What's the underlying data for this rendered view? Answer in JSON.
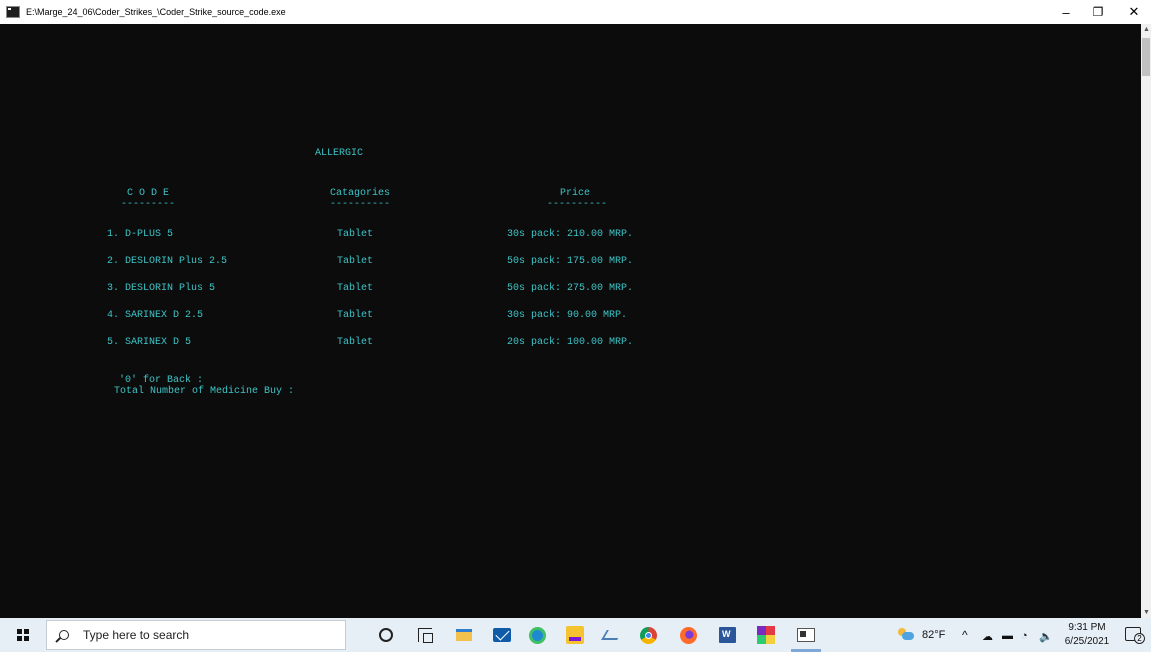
{
  "window": {
    "title": "E:\\Marge_24_06\\Coder_Strikes_\\Coder_Strike_source_code.exe",
    "controls": {
      "minimize": "–",
      "maximize": "❐",
      "close": "✕"
    }
  },
  "console": {
    "heading": "ALLERGIC",
    "columns": {
      "code": "C O D E",
      "code_rule": "---------",
      "categories": "Catagories",
      "categories_rule": "----------",
      "price": "Price",
      "price_rule": "----------"
    },
    "rows": [
      {
        "code": "1. D-PLUS 5",
        "category": "Tablet",
        "price": "30s pack: 210.00 MRP."
      },
      {
        "code": "2. DESLORIN Plus 2.5",
        "category": "Tablet",
        "price": "50s pack: 175.00 MRP."
      },
      {
        "code": "3. DESLORIN Plus 5",
        "category": "Tablet",
        "price": "50s pack: 275.00 MRP."
      },
      {
        "code": "4. SARINEX D 2.5",
        "category": "Tablet",
        "price": "30s pack: 90.00 MRP."
      },
      {
        "code": "5. SARINEX D 5",
        "category": "Tablet",
        "price": "20s pack: 100.00 MRP."
      }
    ],
    "back_prompt": "'0' for Back :",
    "total_prompt": "Total Number of Medicine Buy :",
    "text_color": "#3ec5c8",
    "background": "#0c0c0c"
  },
  "taskbar": {
    "search_placeholder": "Type here to search",
    "apps": [
      "cortana-icon",
      "task-view-icon",
      "file-explorer-icon",
      "mail-icon",
      "edge-icon",
      "player-icon",
      "pen-icon",
      "chrome-icon",
      "firefox-icon",
      "word-icon",
      "codeblocks-icon",
      "console-window-icon"
    ],
    "weather_temp": "82°F",
    "tray_chevron": "^",
    "clock_time": "9:31 PM",
    "clock_date": "6/25/2021",
    "notification_count": "2"
  }
}
